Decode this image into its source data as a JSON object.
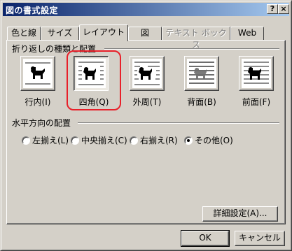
{
  "window": {
    "title": "図の書式設定",
    "help_label": "?",
    "close_label": "×"
  },
  "tabs": [
    {
      "label": "色と線",
      "active": false,
      "disabled": false
    },
    {
      "label": "サイズ",
      "active": false,
      "disabled": false
    },
    {
      "label": "レイアウト",
      "active": true,
      "disabled": false
    },
    {
      "label": "図",
      "active": false,
      "disabled": false
    },
    {
      "label": "テキスト ボックス",
      "active": false,
      "disabled": true
    },
    {
      "label": "Web",
      "active": false,
      "disabled": false
    }
  ],
  "wrap_group": {
    "label": "折り返しの種類と配置",
    "options": [
      {
        "label": "行内(I)",
        "icon": "inline-wrap-icon",
        "selected": false
      },
      {
        "label": "四角(Q)",
        "icon": "square-wrap-icon",
        "selected": true
      },
      {
        "label": "外周(T)",
        "icon": "tight-wrap-icon",
        "selected": false
      },
      {
        "label": "背面(B)",
        "icon": "behind-text-icon",
        "selected": false
      },
      {
        "label": "前面(F)",
        "icon": "in-front-of-text-icon",
        "selected": false
      }
    ]
  },
  "horizontal_group": {
    "label": "水平方向の配置",
    "options": [
      {
        "label": "左揃え(L)",
        "checked": false
      },
      {
        "label": "中央揃え(C)",
        "checked": false
      },
      {
        "label": "右揃え(R)",
        "checked": false
      },
      {
        "label": "その他(O)",
        "checked": true
      }
    ]
  },
  "buttons": {
    "advanced": "詳細設定(A)...",
    "ok": "OK",
    "cancel": "キャンセル"
  },
  "colors": {
    "titlebar_start": "#0a246a",
    "titlebar_end": "#a6caf0",
    "face": "#d4d0c8",
    "highlight_ring": "#e8202a"
  }
}
